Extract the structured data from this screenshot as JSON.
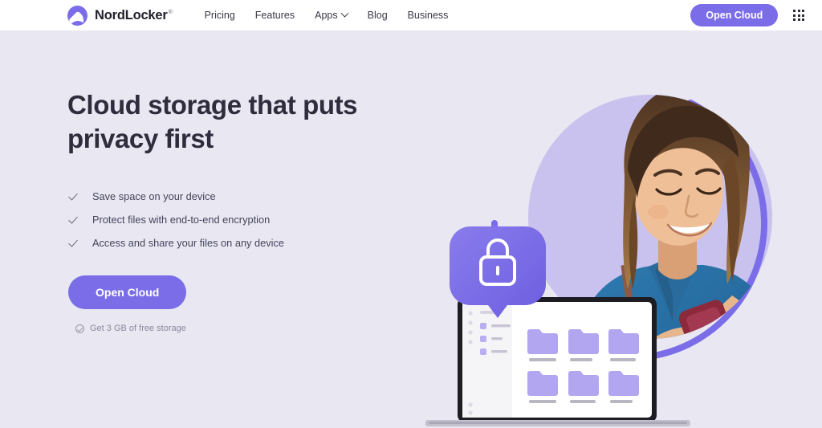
{
  "header": {
    "brand": {
      "name": "NordLocker",
      "trademark": "®",
      "logo_icon": "nordlocker-mountain-logo"
    },
    "nav": [
      {
        "label": "Pricing",
        "has_dropdown": false
      },
      {
        "label": "Features",
        "has_dropdown": false
      },
      {
        "label": "Apps",
        "has_dropdown": true
      },
      {
        "label": "Blog",
        "has_dropdown": false
      },
      {
        "label": "Business",
        "has_dropdown": false
      }
    ],
    "cta_label": "Open Cloud",
    "apps_grid_icon": "apps-grid-icon"
  },
  "hero": {
    "headline_line1": "Cloud storage that puts",
    "headline_line2": "privacy first",
    "bullets": [
      "Save space on your device",
      "Protect files with end-to-end encryption",
      "Access and share your files on any device"
    ],
    "cta_label": "Open Cloud",
    "subnote": "Get 3 GB of free storage",
    "illustration": {
      "badge_icon": "padlock-icon",
      "device": "laptop-file-manager",
      "person": "woman-with-phone-photo",
      "folder_count": 6
    }
  },
  "colors": {
    "brand_purple": "#7B6DE8",
    "hero_background": "#E8E7F2",
    "header_background": "#FFFFFF",
    "heading_text": "#2F2D3C",
    "body_text": "#46445A",
    "muted_text": "#8A889A",
    "circle_lavender": "#C9C2EE"
  }
}
